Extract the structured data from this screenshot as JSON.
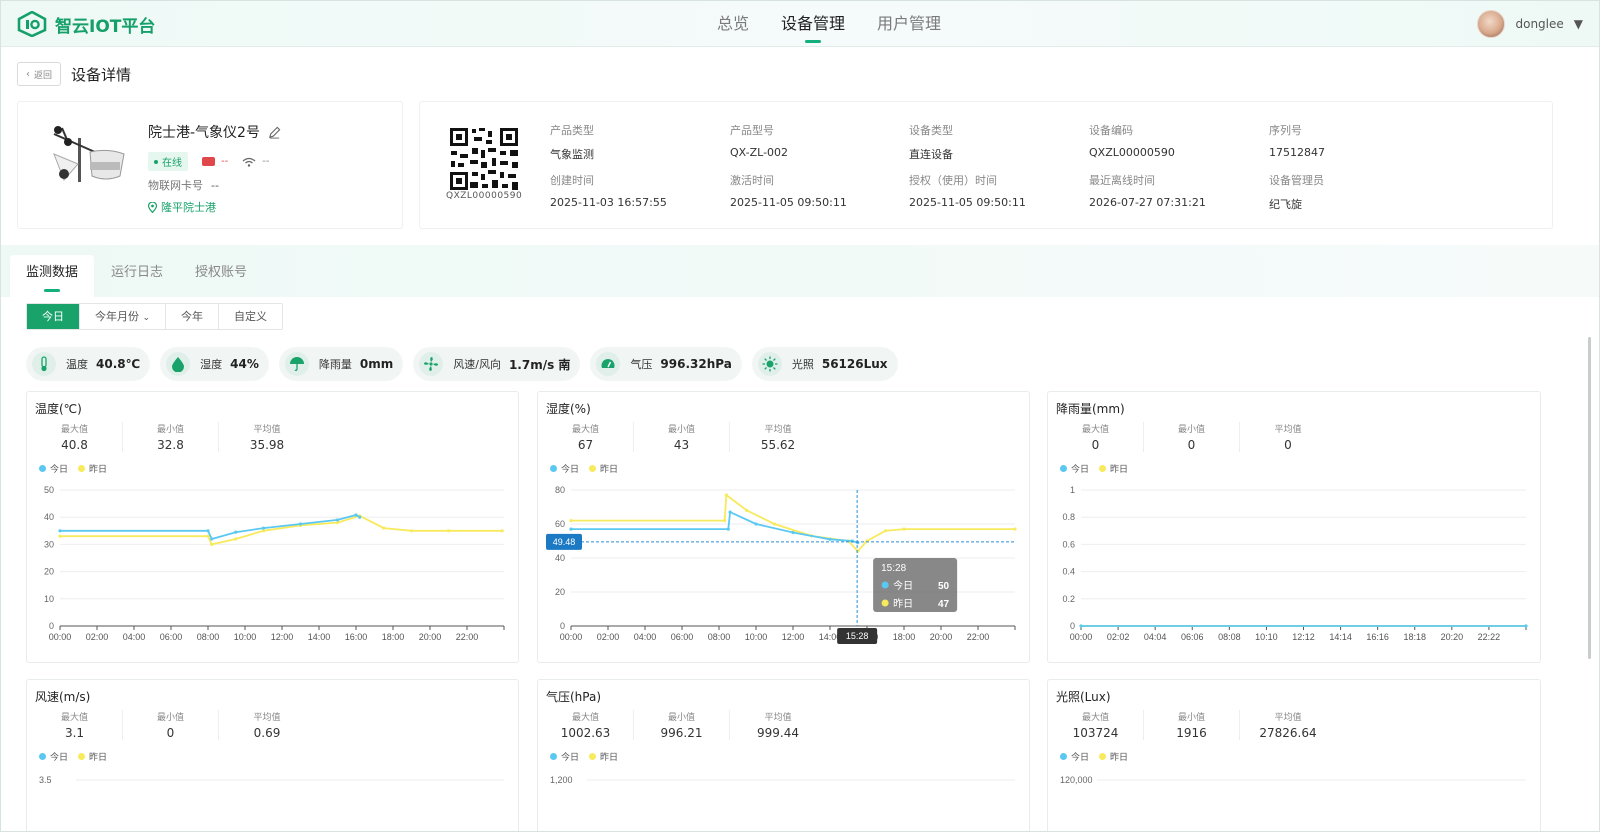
{
  "app": {
    "name": "智云IOT平台"
  },
  "nav": {
    "items": [
      {
        "label": "总览"
      },
      {
        "label": "设备管理"
      },
      {
        "label": "用户管理"
      }
    ]
  },
  "user": {
    "name": "donglee"
  },
  "header": {
    "back": "返回",
    "title": "设备详情"
  },
  "device": {
    "name": "院士港-气象仪2号",
    "status": "在线",
    "battery": "--",
    "signal": "--",
    "iot_card_label": "物联网卡号",
    "iot_card_value": "--",
    "location": "隆平院士港",
    "qr_code": "QXZL00000590"
  },
  "info": [
    {
      "label": "产品类型",
      "value": "气象监测"
    },
    {
      "label": "产品型号",
      "value": "QX-ZL-002"
    },
    {
      "label": "设备类型",
      "value": "直连设备"
    },
    {
      "label": "设备编码",
      "value": "QXZL00000590"
    },
    {
      "label": "序列号",
      "value": "17512847"
    },
    {
      "label": "创建时间",
      "value": "2025-11-03 16:57:55"
    },
    {
      "label": "激活时间",
      "value": "2025-11-05 09:50:11"
    },
    {
      "label": "授权（使用）时间",
      "value": "2025-11-05 09:50:11"
    },
    {
      "label": "最近离线时间",
      "value": "2026-07-27 07:31:21"
    },
    {
      "label": "设备管理员",
      "value": "纪飞旋"
    }
  ],
  "tabs": [
    {
      "label": "监测数据"
    },
    {
      "label": "运行日志"
    },
    {
      "label": "授权账号"
    }
  ],
  "filters": [
    {
      "label": "今日"
    },
    {
      "label": "今年月份"
    },
    {
      "label": "今年"
    },
    {
      "label": "自定义"
    }
  ],
  "metrics": [
    {
      "label": "温度",
      "value": "40.8℃",
      "icon": "thermometer-icon"
    },
    {
      "label": "湿度",
      "value": "44%",
      "icon": "droplet-icon"
    },
    {
      "label": "降雨量",
      "value": "0mm",
      "icon": "umbrella-icon"
    },
    {
      "label": "风速/风向",
      "value": "1.7m/s 南",
      "icon": "fan-icon"
    },
    {
      "label": "气压",
      "value": "996.32hPa",
      "icon": "gauge-icon"
    },
    {
      "label": "光照",
      "value": "56126Lux",
      "icon": "sun-icon"
    }
  ],
  "legend": {
    "today": "今日",
    "yesterday": "昨日"
  },
  "stat_labels": {
    "max": "最大值",
    "min": "最小值",
    "avg": "平均值"
  },
  "colors": {
    "accent": "#19a36b",
    "today": "#5bc8f2",
    "yesterday": "#f7ea5c"
  },
  "chart_data": [
    {
      "type": "line",
      "title": "温度(℃)",
      "stats": {
        "max": "40.8",
        "min": "32.8",
        "avg": "35.98"
      },
      "x_ticks": [
        "00:00",
        "02:00",
        "04:00",
        "06:00",
        "08:00",
        "10:00",
        "12:00",
        "14:00",
        "16:00",
        "18:00",
        "20:00",
        "22:00"
      ],
      "y_ticks": [
        "0",
        "10",
        "20",
        "30",
        "40",
        "50"
      ],
      "ylim": [
        0,
        50
      ],
      "series": [
        {
          "name": "今日",
          "x": [
            0,
            8,
            8.2,
            9.5,
            11,
            13,
            15,
            16,
            16.2
          ],
          "y": [
            35,
            35,
            32,
            34.5,
            36,
            37.5,
            39,
            40.8,
            40
          ]
        },
        {
          "name": "昨日",
          "x": [
            0,
            8,
            8.2,
            9.5,
            11,
            13,
            15,
            16.2,
            17.5,
            19,
            21,
            23.9
          ],
          "y": [
            33,
            33,
            30,
            32,
            35,
            37,
            38,
            40.5,
            36,
            35,
            35,
            35
          ]
        }
      ]
    },
    {
      "type": "line",
      "title": "湿度(%)",
      "stats": {
        "max": "67",
        "min": "43",
        "avg": "55.62"
      },
      "x_ticks": [
        "00:00",
        "02:00",
        "04:00",
        "06:00",
        "08:00",
        "10:00",
        "12:00",
        "14:00",
        "16:00",
        "18:00",
        "20:00",
        "22:00"
      ],
      "y_ticks": [
        "0",
        "20",
        "40",
        "60",
        "80"
      ],
      "ylim": [
        0,
        80
      ],
      "crosshair": {
        "x_label": "15:28",
        "y_label": "49.48",
        "tooltip_time": "15:28",
        "today": "50",
        "yesterday": "47"
      },
      "series": [
        {
          "name": "今日",
          "x": [
            0,
            8.5,
            8.6,
            10,
            12,
            14,
            15.2,
            15.5
          ],
          "y": [
            57,
            57,
            67,
            60,
            55,
            51,
            50,
            49
          ]
        },
        {
          "name": "昨日",
          "x": [
            0,
            8.3,
            8.4,
            9.5,
            11,
            13,
            15,
            15.5,
            16,
            17,
            18,
            24
          ],
          "y": [
            62,
            62,
            77,
            68,
            60,
            53,
            50,
            44,
            50,
            56,
            57,
            57
          ]
        }
      ]
    },
    {
      "type": "line",
      "title": "降雨量(mm)",
      "stats": {
        "max": "0",
        "min": "0",
        "avg": "0"
      },
      "x_ticks": [
        "00:00",
        "02:02",
        "04:04",
        "06:06",
        "08:08",
        "10:10",
        "12:12",
        "14:14",
        "16:16",
        "18:18",
        "20:20",
        "22:22"
      ],
      "y_ticks": [
        "0",
        "0.2",
        "0.4",
        "0.6",
        "0.8",
        "1"
      ],
      "ylim": [
        0,
        1
      ],
      "series": [
        {
          "name": "今日",
          "x": [
            0,
            24
          ],
          "y": [
            0,
            0
          ]
        },
        {
          "name": "昨日",
          "x": [
            0,
            24
          ],
          "y": [
            0,
            0
          ]
        }
      ]
    },
    {
      "type": "line",
      "title": "风速(m/s)",
      "stats": {
        "max": "3.1",
        "min": "0",
        "avg": "0.69"
      },
      "y_ticks": [
        "3.5"
      ],
      "series": []
    },
    {
      "type": "line",
      "title": "气压(hPa)",
      "stats": {
        "max": "1002.63",
        "min": "996.21",
        "avg": "999.44"
      },
      "y_ticks": [
        "1,200"
      ],
      "series": []
    },
    {
      "type": "line",
      "title": "光照(Lux)",
      "stats": {
        "max": "103724",
        "min": "1916",
        "avg": "27826.64"
      },
      "y_ticks": [
        "120,000"
      ],
      "series": []
    }
  ]
}
